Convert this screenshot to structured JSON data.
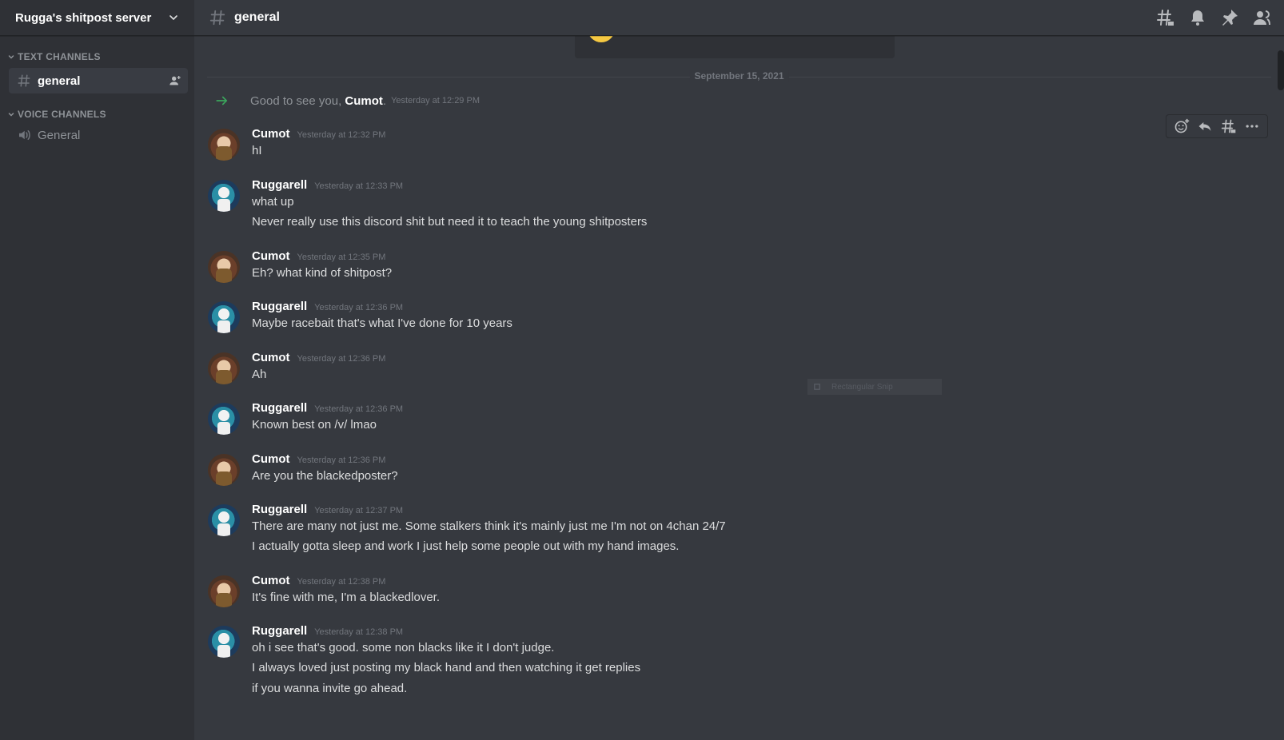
{
  "server": {
    "name": "Rugga's shitpost server"
  },
  "categories": {
    "text": "TEXT CHANNELS",
    "voice": "VOICE CHANNELS"
  },
  "text_channels": [
    {
      "label": "general"
    }
  ],
  "voice_channels": [
    {
      "label": "General"
    }
  ],
  "channel": {
    "title": "general"
  },
  "date_divider": "September 15, 2021",
  "join": {
    "prefix": "Good to see you, ",
    "name": "Cumot",
    "suffix": ".",
    "timestamp": "Yesterday at 12:29 PM"
  },
  "snip_label": "Rectangular Snip",
  "messages": [
    {
      "author": "Cumot",
      "timestamp": "Yesterday at 12:32 PM",
      "lines": [
        "hI"
      ]
    },
    {
      "author": "Ruggarell",
      "timestamp": "Yesterday at 12:33 PM",
      "lines": [
        "what up",
        "Never really use this discord shit but need it to teach the young shitposters"
      ]
    },
    {
      "author": "Cumot",
      "timestamp": "Yesterday at 12:35 PM",
      "lines": [
        "Eh? what kind of shitpost?"
      ]
    },
    {
      "author": "Ruggarell",
      "timestamp": "Yesterday at 12:36 PM",
      "lines": [
        "Maybe racebait that's what I've done for 10 years"
      ]
    },
    {
      "author": "Cumot",
      "timestamp": "Yesterday at 12:36 PM",
      "lines": [
        "Ah"
      ]
    },
    {
      "author": "Ruggarell",
      "timestamp": "Yesterday at 12:36 PM",
      "lines": [
        "Known best on /v/ lmao"
      ]
    },
    {
      "author": "Cumot",
      "timestamp": "Yesterday at 12:36 PM",
      "lines": [
        "Are you the blackedposter?"
      ]
    },
    {
      "author": "Ruggarell",
      "timestamp": "Yesterday at 12:37 PM",
      "lines": [
        "There are many not just me. Some stalkers think it's mainly just me I'm not on 4chan 24/7",
        "I actually gotta sleep and work I just help some people out with my hand images."
      ]
    },
    {
      "author": "Cumot",
      "timestamp": "Yesterday at 12:38 PM",
      "lines": [
        "It's fine with me, I'm a blackedlover."
      ]
    },
    {
      "author": "Ruggarell",
      "timestamp": "Yesterday at 12:38 PM",
      "lines": [
        "oh i see that's good. some non blacks like it I don't judge.",
        "I always loved just posting my black hand and then watching it get replies",
        "if you wanna invite go ahead."
      ]
    }
  ]
}
